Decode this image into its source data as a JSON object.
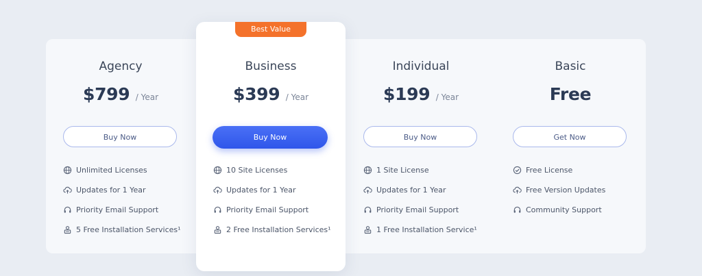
{
  "badge": "Best Value",
  "plans": [
    {
      "name": "Agency",
      "price": "$799",
      "period": "/ Year",
      "cta": "Buy Now",
      "features": [
        {
          "icon": "globe-icon",
          "text": "Unlimited Licenses"
        },
        {
          "icon": "cloud-upload-icon",
          "text": "Updates for 1 Year"
        },
        {
          "icon": "headset-icon",
          "text": "Priority Email Support"
        },
        {
          "icon": "installer-icon",
          "text": "5 Free Installation Services¹"
        }
      ]
    },
    {
      "name": "Business",
      "price": "$399",
      "period": "/ Year",
      "cta": "Buy Now",
      "features": [
        {
          "icon": "globe-icon",
          "text": "10 Site Licenses"
        },
        {
          "icon": "cloud-upload-icon",
          "text": "Updates for 1 Year"
        },
        {
          "icon": "headset-icon",
          "text": "Priority Email Support"
        },
        {
          "icon": "installer-icon",
          "text": "2 Free Installation Services¹"
        }
      ]
    },
    {
      "name": "Individual",
      "price": "$199",
      "period": "/ Year",
      "cta": "Buy Now",
      "features": [
        {
          "icon": "globe-icon",
          "text": "1 Site License"
        },
        {
          "icon": "cloud-upload-icon",
          "text": "Updates for 1 Year"
        },
        {
          "icon": "headset-icon",
          "text": "Priority Email Support"
        },
        {
          "icon": "installer-icon",
          "text": "1 Free Installation Service¹"
        }
      ]
    },
    {
      "name": "Basic",
      "price": "Free",
      "period": "",
      "cta": "Get Now",
      "features": [
        {
          "icon": "check-circle-icon",
          "text": "Free License"
        },
        {
          "icon": "cloud-upload-icon",
          "text": "Free Version Updates"
        },
        {
          "icon": "headset-icon",
          "text": "Community Support"
        }
      ]
    }
  ],
  "colors": {
    "accent": "#3a62f0",
    "badge": "#f4722b",
    "text": "#2b3a55"
  }
}
